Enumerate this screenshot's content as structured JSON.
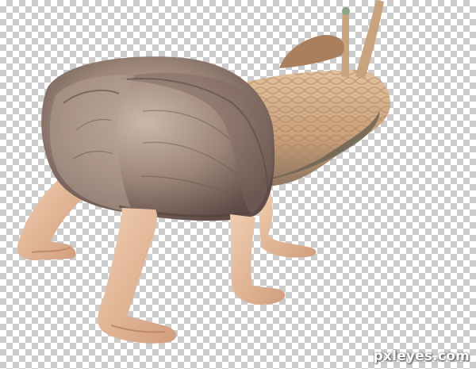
{
  "image": {
    "subject": "snail-baby-composite",
    "colors": {
      "checker_light": "#ffffff",
      "checker_dark": "#cccccc",
      "shell_base": "#9b8578",
      "shell_dark": "#6e5b55",
      "shell_light": "#cbb8a8",
      "snail_body": "#d8b590",
      "snail_body_dark": "#6d6455",
      "skin": "#e9bf9e",
      "skin_shadow": "#c99475"
    }
  },
  "watermark": {
    "text": "pxleyes.com"
  }
}
